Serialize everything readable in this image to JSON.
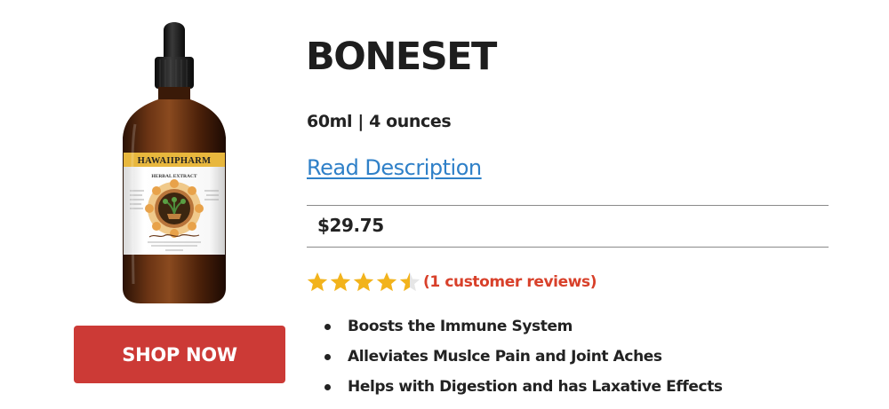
{
  "product": {
    "brand": "HAWAIIPHARM",
    "label_subtitle": "HERBAL EXTRACT",
    "name": "BONESET",
    "size": "60ml | 4 ounces",
    "read_description": "Read Description",
    "price": "$29.75",
    "rating": {
      "value": 4.5,
      "max": 5,
      "reviews_text": "(1 customer reviews)"
    },
    "features": [
      "Boosts the Immune System",
      "Alleviates Muslce Pain and Joint Aches",
      "Helps with Digestion and has Laxative Effects"
    ],
    "shop_button": "SHOP NOW"
  },
  "colors": {
    "button": "#cc3a36",
    "link": "#2f80c8",
    "reviews": "#d8402a",
    "star": "#f2b31c"
  },
  "icons": {
    "star": "star-icon",
    "bullet": "bullet-icon"
  }
}
